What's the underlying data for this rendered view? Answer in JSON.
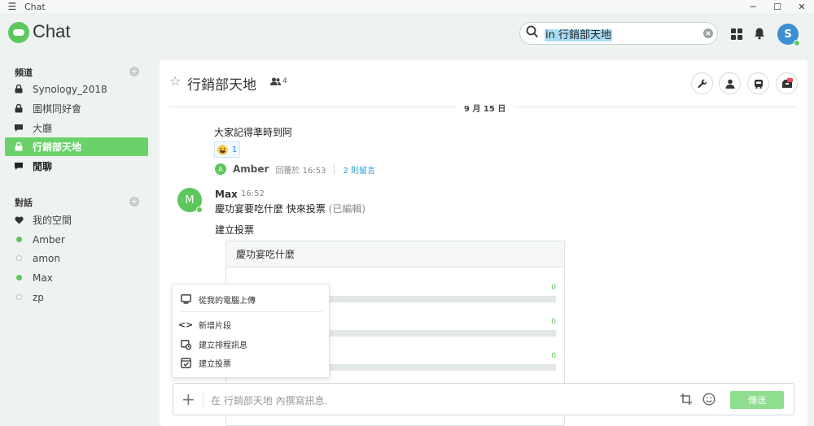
{
  "window": {
    "title": "Chat"
  },
  "app": {
    "name": "Chat"
  },
  "search": {
    "prefix": "in",
    "value": "行銷部天地"
  },
  "user": {
    "avatar_letter": "S"
  },
  "sidebar": {
    "channels_title": "頻道",
    "channels": [
      {
        "label": "Synology_2018",
        "icon": "lock-icon"
      },
      {
        "label": "圍棋同好會",
        "icon": "lock-icon"
      },
      {
        "label": "大廳",
        "icon": "chat-bubble-icon"
      },
      {
        "label": "行銷部天地",
        "icon": "lock-icon",
        "active": true
      },
      {
        "label": "閒聊",
        "icon": "chat-bubble-icon",
        "bold": true
      }
    ],
    "conversations_title": "對話",
    "conversations": [
      {
        "label": "我的空間",
        "icon": "heart-icon"
      },
      {
        "label": "Amber",
        "status": "online"
      },
      {
        "label": "amon",
        "status": "offline"
      },
      {
        "label": "Max",
        "status": "online"
      },
      {
        "label": "zp",
        "status": "offline"
      }
    ]
  },
  "channel": {
    "title": "行銷部天地",
    "member_count": "4"
  },
  "date_divider": "9 月 15 日",
  "message1": {
    "text": "大家記得準時到阿",
    "reaction_count": "1",
    "reply_avatar": "A",
    "reply_author": "Amber",
    "reply_meta": "回覆於 16:53",
    "reply_link": "2 則留言"
  },
  "message2": {
    "avatar": "M",
    "author": "Max",
    "time": "16:52",
    "text": "慶功宴要吃什麼 快來投票",
    "edited": "(已編輯)",
    "poll_intro": "建立投票",
    "poll_title": "慶功宴吃什麼",
    "poll_options": [
      {
        "count": "0",
        "fraction": 0
      },
      {
        "count": "0",
        "fraction": 0
      },
      {
        "count": "0",
        "fraction": 0
      }
    ]
  },
  "context_menu": {
    "upload": "從我的電腦上傳",
    "snippet": "新增片段",
    "schedule": "建立排程訊息",
    "poll": "建立投票"
  },
  "composer": {
    "placeholder": "在 行銷部天地 內撰寫訊息.",
    "send_label": "傳送"
  },
  "colors": {
    "accent": "#6bd26b",
    "link": "#2d9ad6",
    "avatar_user": "#3d8fd1"
  }
}
